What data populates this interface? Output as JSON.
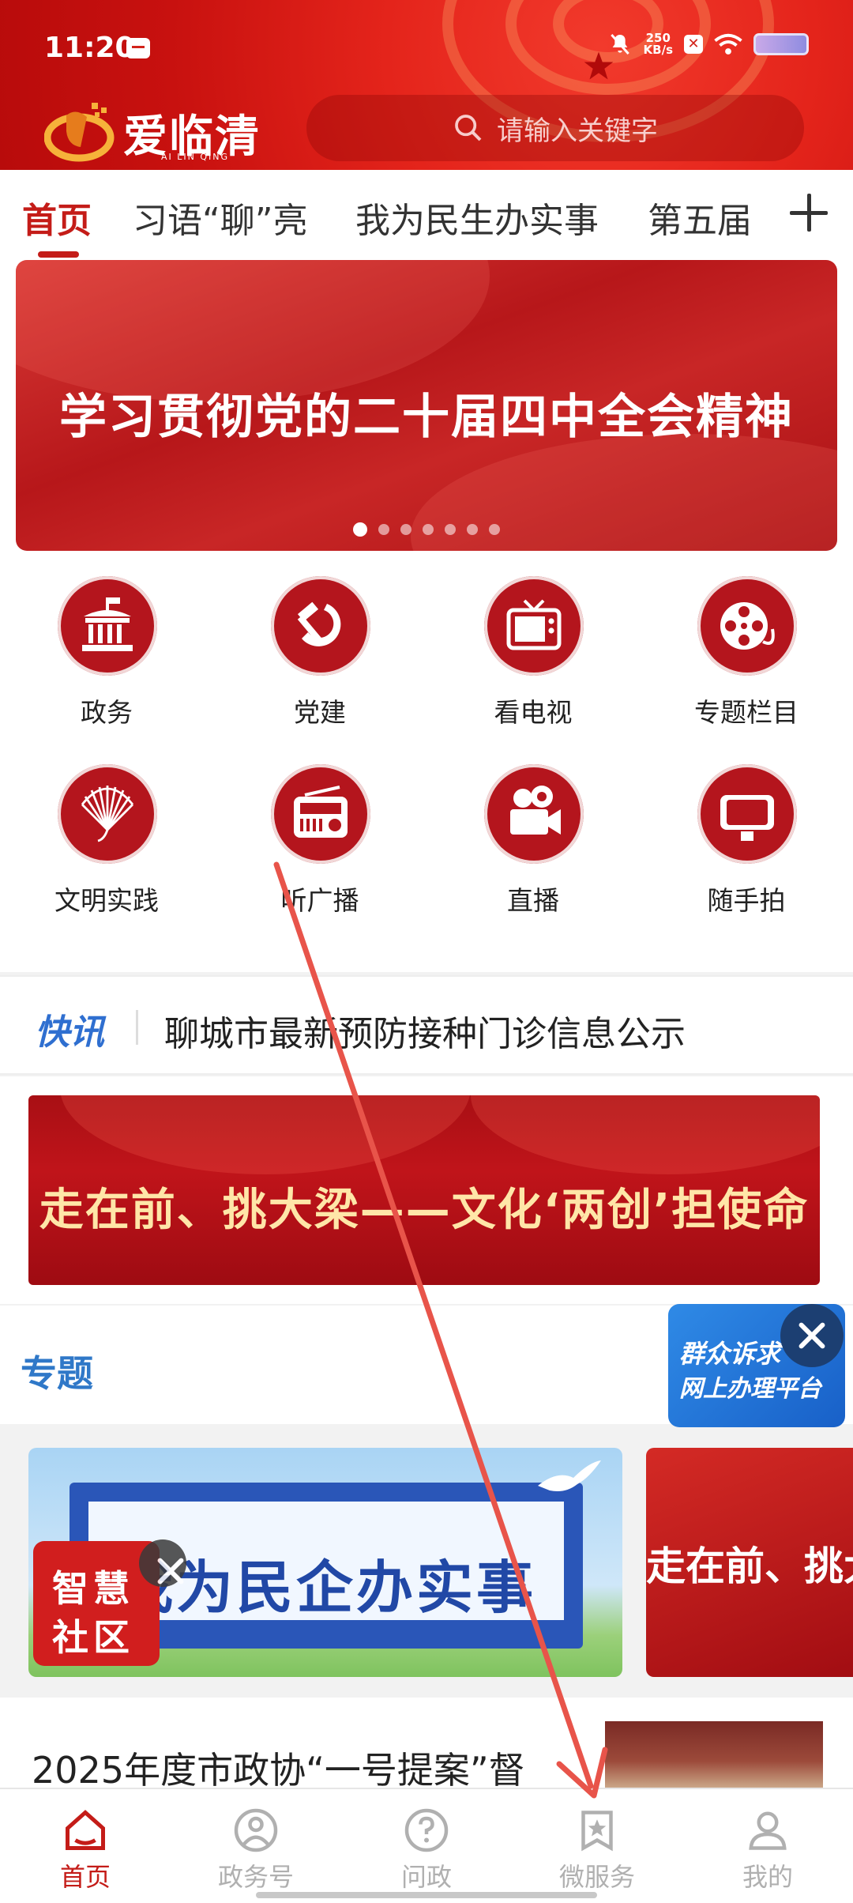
{
  "status_bar": {
    "time": "11:20",
    "net_speed_value": "250",
    "net_speed_unit": "KB/s",
    "icons": [
      "message-icon",
      "mute-icon",
      "x-app-icon",
      "wifi-icon",
      "battery-icon"
    ]
  },
  "header": {
    "app_name": "爱临清",
    "app_name_latin": "AI LIN QING",
    "search_placeholder": "请输入关键字",
    "accent": "#e4241b"
  },
  "tabs": [
    {
      "label": "首页"
    },
    {
      "label": "习语“聊”亮"
    },
    {
      "label": "我为民生办实事"
    },
    {
      "label": "第五届"
    }
  ],
  "banner": {
    "title": "学习贯彻党的二十届四中全会精神",
    "slide_count": 7,
    "active_slide": 1
  },
  "grid": [
    {
      "label": "政务",
      "icon": "government-building-icon"
    },
    {
      "label": "党建",
      "icon": "hammer-sickle-icon"
    },
    {
      "label": "看电视",
      "icon": "tv-icon"
    },
    {
      "label": "专题栏目",
      "icon": "film-reel-icon"
    },
    {
      "label": "文明实践",
      "icon": "fan-icon"
    },
    {
      "label": "听广播",
      "icon": "radio-icon"
    },
    {
      "label": "直播",
      "icon": "video-camera-icon"
    },
    {
      "label": "随手拍",
      "icon": "phone-camera-icon"
    }
  ],
  "news_flash": {
    "tag": "快讯",
    "text": "聊城市最新预防接种门诊信息公示"
  },
  "promo": {
    "title": "走在前、挑大梁——文化‘两创’担使命"
  },
  "topics": {
    "label": "专题",
    "card1_title": "我为民企办实事",
    "card2_title": "走在前、挑大"
  },
  "floating": {
    "appeal_line1": "群众诉求",
    "appeal_line2": "网上办理平台",
    "community_line1": "智慧",
    "community_line2": "社区"
  },
  "article": {
    "title": "2025年度市政协“一号提案”督"
  },
  "bottom_nav": [
    {
      "label": "首页",
      "icon": "home-icon",
      "active": true
    },
    {
      "label": "政务号",
      "icon": "government-account-icon",
      "active": false
    },
    {
      "label": "问政",
      "icon": "question-icon",
      "active": false
    },
    {
      "label": "微服务",
      "icon": "star-bookmark-icon",
      "active": false
    },
    {
      "label": "我的",
      "icon": "profile-icon",
      "active": false
    }
  ],
  "colors": {
    "brand_red": "#c41c18",
    "icon_red": "#b4151d",
    "link_blue": "#2f6fd0",
    "annotation_arrow": "#e8544a"
  }
}
